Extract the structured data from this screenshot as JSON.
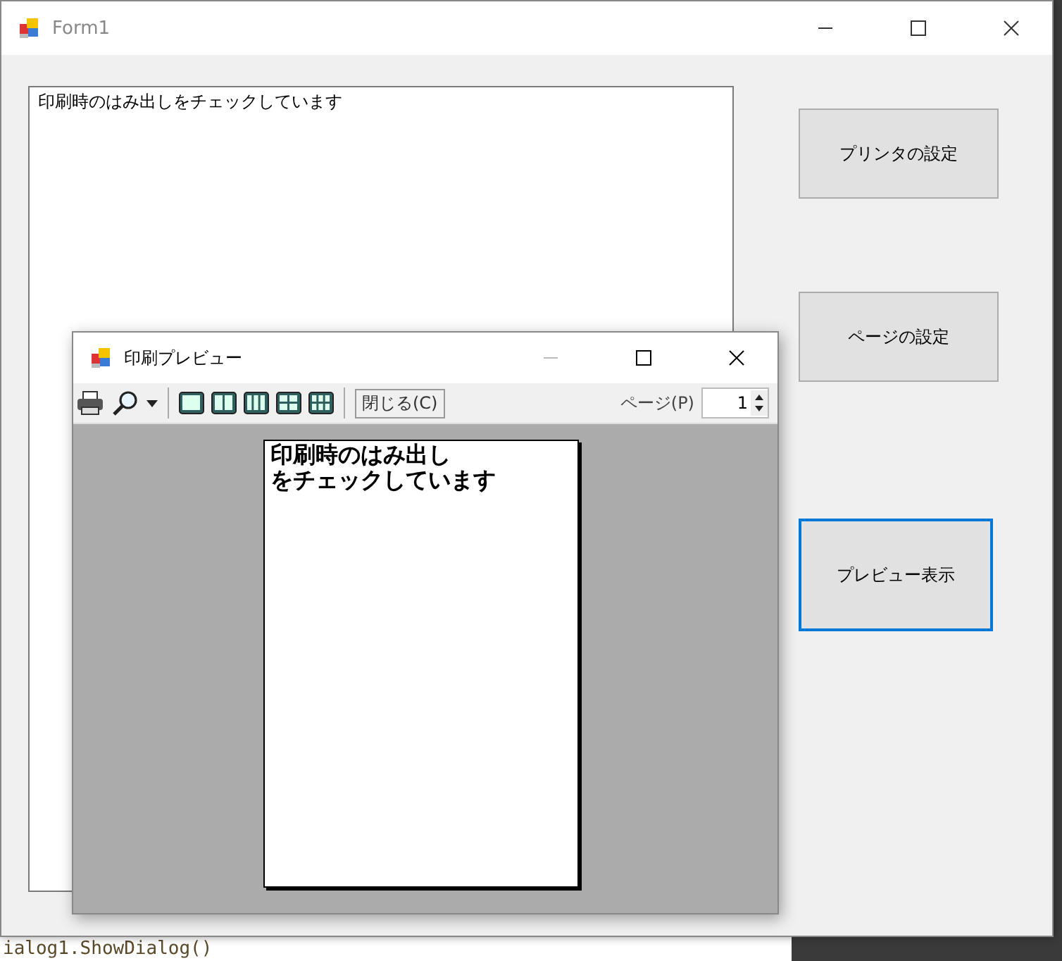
{
  "window": {
    "title": "Form1"
  },
  "text_box": {
    "value": "印刷時のはみ出しをチェックしています"
  },
  "buttons": [
    {
      "label": "プリンタの設定",
      "focused": false
    },
    {
      "label": "ページの設定",
      "focused": false
    },
    {
      "label": "プレビュー表示",
      "focused": true
    }
  ],
  "preview": {
    "title": "印刷プレビュー",
    "close_button": "閉じる(C)",
    "page_label": "ページ(P)",
    "page_value": "1",
    "page_lines": [
      "印刷時のはみ出し",
      "をチェックしています"
    ]
  },
  "background_code": "ialog1.ShowDialog()"
}
